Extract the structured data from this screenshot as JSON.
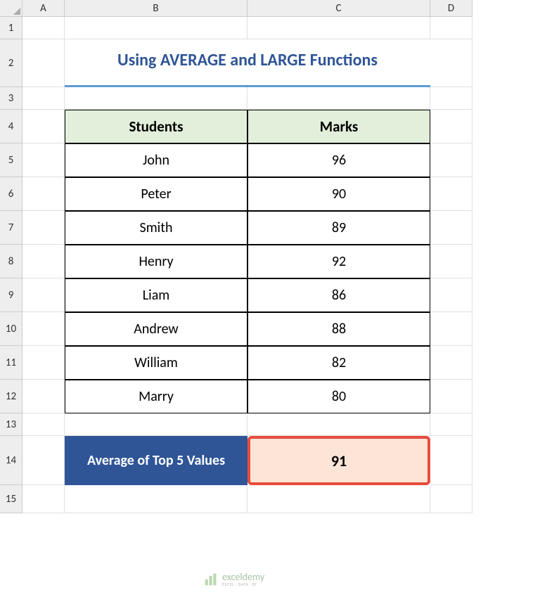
{
  "columns": [
    "",
    "A",
    "B",
    "C",
    "D"
  ],
  "rows": [
    "1",
    "2",
    "3",
    "4",
    "5",
    "6",
    "7",
    "8",
    "9",
    "10",
    "11",
    "12",
    "13",
    "14",
    "15"
  ],
  "title": "Using AVERAGE and LARGE Functions",
  "table": {
    "headers": {
      "students": "Students",
      "marks": "Marks"
    },
    "data": [
      {
        "student": "John",
        "marks": "96"
      },
      {
        "student": "Peter",
        "marks": "90"
      },
      {
        "student": "Smith",
        "marks": "89"
      },
      {
        "student": "Henry",
        "marks": "92"
      },
      {
        "student": "Liam",
        "marks": "86"
      },
      {
        "student": "Andrew",
        "marks": "88"
      },
      {
        "student": "William",
        "marks": "82"
      },
      {
        "student": "Marry",
        "marks": "80"
      }
    ]
  },
  "result": {
    "label": "Average of Top 5 Values",
    "value": "91"
  },
  "watermark": {
    "brand": "exceldemy",
    "tagline": "EXCEL · DATA · BI"
  },
  "chart_data": {
    "type": "table",
    "title": "Using AVERAGE and LARGE Functions",
    "columns": [
      "Students",
      "Marks"
    ],
    "rows": [
      [
        "John",
        96
      ],
      [
        "Peter",
        90
      ],
      [
        "Smith",
        89
      ],
      [
        "Henry",
        92
      ],
      [
        "Liam",
        86
      ],
      [
        "Andrew",
        88
      ],
      [
        "William",
        82
      ],
      [
        "Marry",
        80
      ]
    ],
    "summary": {
      "label": "Average of Top 5 Values",
      "value": 91
    }
  }
}
